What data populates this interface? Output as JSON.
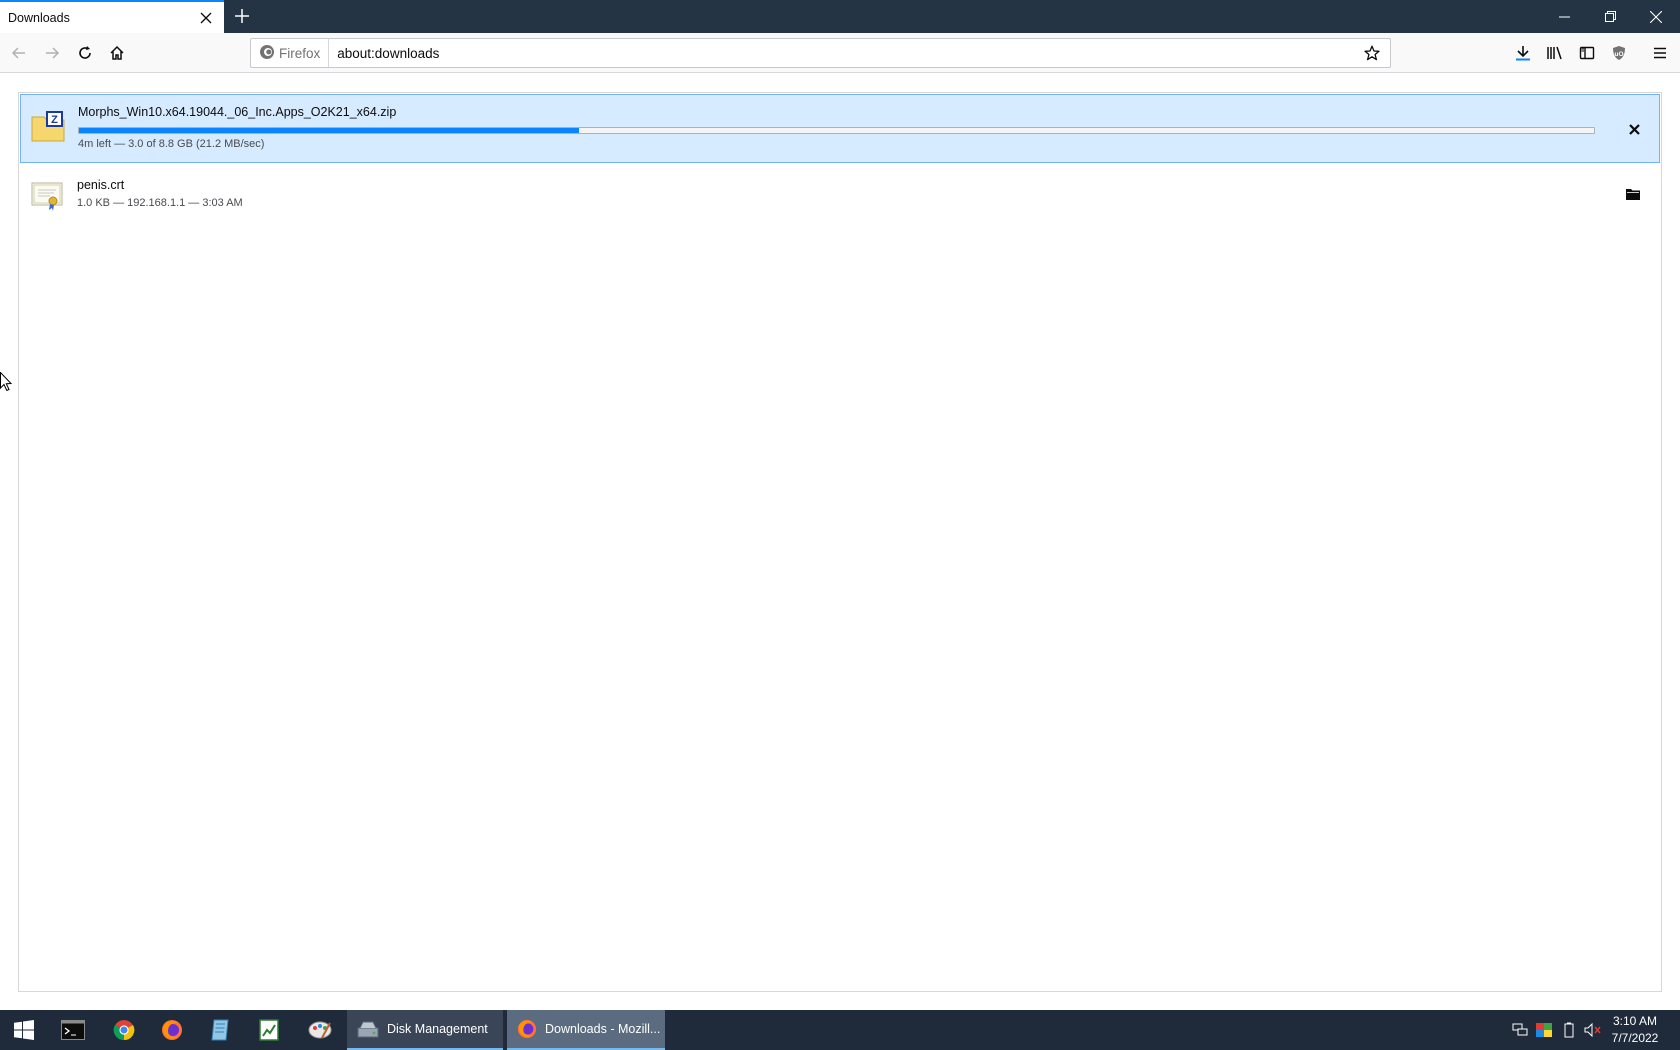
{
  "browser": {
    "tab": {
      "title": "Downloads"
    },
    "identity_label": "Firefox",
    "url": "about:downloads"
  },
  "downloads": [
    {
      "name": "Morphs_Win10.x64.19044._06_Inc.Apps_O2K21_x64.zip",
      "status": "4m left — 3.0 of 8.8 GB (21.2 MB/sec)",
      "progress_percent": 33,
      "icon": "zip-archive-icon",
      "action": "cancel-icon"
    },
    {
      "name": "penis.crt",
      "status": "1.0 KB — 192.168.1.1 — 3:03 AM",
      "icon": "certificate-file-icon",
      "action": "folder-icon"
    }
  ],
  "taskbar": {
    "tasks": [
      {
        "label": "Disk Management",
        "icon": "disk-management-icon"
      },
      {
        "label": "Downloads - Mozill...",
        "icon": "firefox-icon"
      }
    ],
    "clock": {
      "time": "3:10 AM",
      "date": "7/7/2022"
    }
  },
  "colors": {
    "accent": "#0a84ff",
    "selected_row": "#d6ebff",
    "tabbar": "#253444",
    "taskbar": "#1f2a3a"
  }
}
